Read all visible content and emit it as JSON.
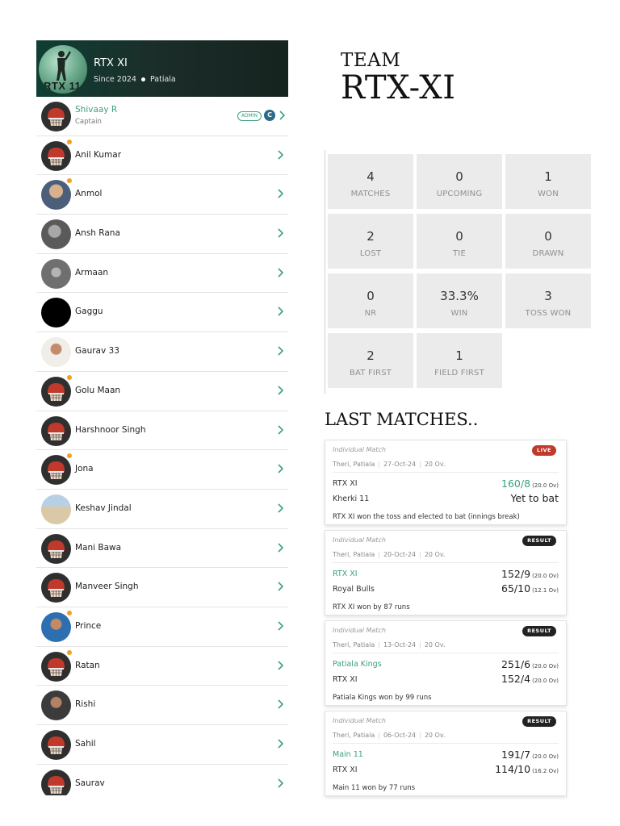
{
  "team_header": {
    "logo_text": "RTX 11",
    "name": "RTX XI",
    "since": "Since 2024",
    "location": "Patiala"
  },
  "roster": {
    "captain": {
      "name": "Shivaay R",
      "role": "Captain",
      "admin_badge": "ADMIN",
      "c_badge": "C"
    },
    "players": [
      {
        "name": "Anil Kumar",
        "avatar": "helmet-icon",
        "online": true
      },
      {
        "name": "Anmol",
        "avatar": "photo-a",
        "online": true
      },
      {
        "name": "Ansh Rana",
        "avatar": "photo-b",
        "online": false
      },
      {
        "name": "Armaan",
        "avatar": "photo-c",
        "online": false
      },
      {
        "name": "Gaggu",
        "avatar": "photo-d",
        "online": false
      },
      {
        "name": "Gaurav 33",
        "avatar": "photo-e",
        "online": false
      },
      {
        "name": "Golu Maan",
        "avatar": "helmet-icon",
        "online": true
      },
      {
        "name": "Harshnoor Singh",
        "avatar": "helmet-icon",
        "online": false
      },
      {
        "name": "Jona",
        "avatar": "helmet-icon",
        "online": true
      },
      {
        "name": "Keshav Jindal",
        "avatar": "photo-f",
        "online": false
      },
      {
        "name": "Mani Bawa",
        "avatar": "helmet-icon",
        "online": false
      },
      {
        "name": "Manveer Singh",
        "avatar": "helmet-icon",
        "online": false
      },
      {
        "name": "Prince",
        "avatar": "photo-g",
        "online": true
      },
      {
        "name": "Ratan",
        "avatar": "helmet-icon",
        "online": true
      },
      {
        "name": "Rishi",
        "avatar": "photo-h",
        "online": false
      },
      {
        "name": "Sahil",
        "avatar": "helmet-icon",
        "online": false
      },
      {
        "name": "Saurav",
        "avatar": "helmet-icon",
        "online": false
      }
    ]
  },
  "title": {
    "label": "TEAM",
    "name": "RTX-XI"
  },
  "stats": [
    {
      "value": "4",
      "label": "MATCHES"
    },
    {
      "value": "0",
      "label": "UPCOMING"
    },
    {
      "value": "1",
      "label": "WON"
    },
    {
      "value": "2",
      "label": "LOST"
    },
    {
      "value": "0",
      "label": "TIE"
    },
    {
      "value": "0",
      "label": "DRAWN"
    },
    {
      "value": "0",
      "label": "NR"
    },
    {
      "value": "33.3%",
      "label": "WIN"
    },
    {
      "value": "3",
      "label": "TOSS WON"
    },
    {
      "value": "2",
      "label": "BAT FIRST"
    },
    {
      "value": "1",
      "label": "FIELD FIRST"
    }
  ],
  "last_matches": {
    "title": "LAST MATCHES..",
    "items": [
      {
        "type": "Individual Match",
        "badge": "LIVE",
        "venue": "Theri, Patiala",
        "date": "27-Oct-24",
        "overs": "20 Ov.",
        "team1": "RTX XI",
        "team1_winner": false,
        "score1": "160/8",
        "overs1": "(20.0 Ov)",
        "team2": "Kherki 11",
        "team2_winner": false,
        "score2": "Yet to bat",
        "overs2": "",
        "result": "RTX XI won the toss and elected to bat (innings break)"
      },
      {
        "type": "Individual Match",
        "badge": "RESULT",
        "venue": "Theri, Patiala",
        "date": "20-Oct-24",
        "overs": "20 Ov.",
        "team1": "RTX XI",
        "team1_winner": true,
        "score1": "152/9",
        "overs1": "(20.0 Ov)",
        "team2": "Royal Bulls",
        "team2_winner": false,
        "score2": "65/10",
        "overs2": "(12.1 Ov)",
        "result": "RTX XI won by 87 runs"
      },
      {
        "type": "Individual Match",
        "badge": "RESULT",
        "venue": "Theri, Patiala",
        "date": "13-Oct-24",
        "overs": "20 Ov.",
        "team1": "Patiala Kings",
        "team1_winner": true,
        "score1": "251/6",
        "overs1": "(20.0 Ov)",
        "team2": "RTX XI",
        "team2_winner": false,
        "score2": "152/4",
        "overs2": "(20.0 Ov)",
        "result": "Patiala Kings won by 99 runs"
      },
      {
        "type": "Individual Match",
        "badge": "RESULT",
        "venue": "Theri, Patiala",
        "date": "06-Oct-24",
        "overs": "20 Ov.",
        "team1": "Main 11",
        "team1_winner": true,
        "score1": "191/7",
        "overs1": "(20.0 Ov)",
        "team2": "RTX XI",
        "team2_winner": false,
        "score2": "114/10",
        "overs2": "(16.2 Ov)",
        "result": "Main 11 won by 77 runs"
      }
    ]
  },
  "colors": {
    "accent_green": "#3aa17d",
    "live_red": "#c0392b",
    "header_dark": "#16231f",
    "online_dot": "#f3a022"
  }
}
